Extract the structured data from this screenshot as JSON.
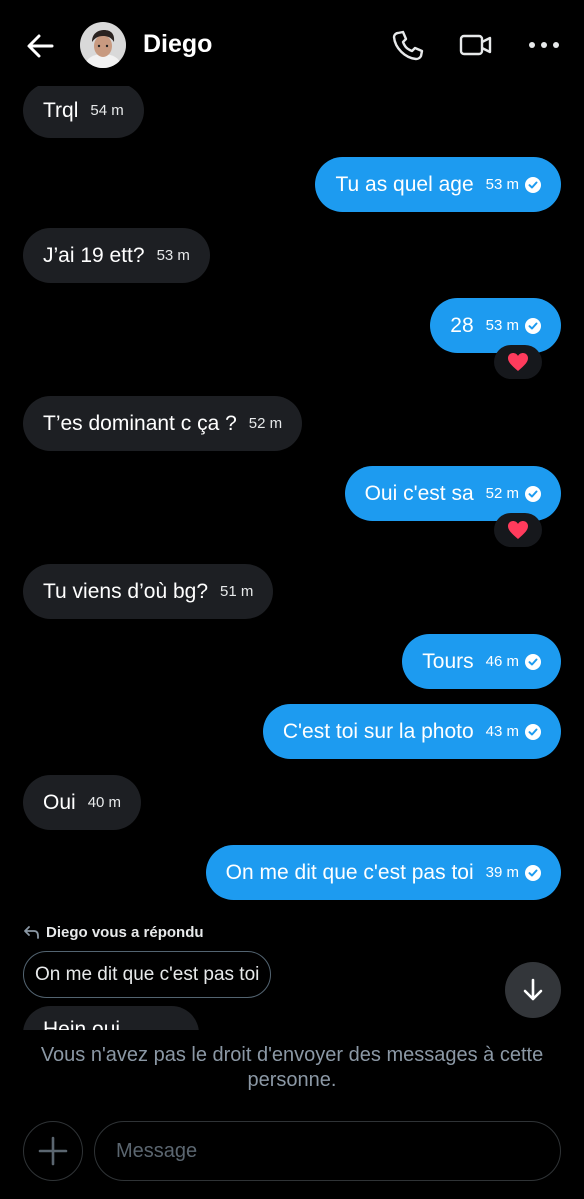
{
  "header": {
    "contact_name": "Diego",
    "icons": [
      "arrow-left-icon",
      "phone-icon",
      "video-camera-icon",
      "more-horizontal-icon"
    ]
  },
  "messages": [
    {
      "dir": "in",
      "text": "Trql",
      "time": "54 m"
    },
    {
      "dir": "out",
      "text": "Tu as  quel age",
      "time": "53 m",
      "seen": true
    },
    {
      "dir": "in",
      "text": "J’ai 19 ett?",
      "time": "53 m"
    },
    {
      "dir": "out",
      "text": "28",
      "time": "53 m",
      "seen": true,
      "reaction": "❤️"
    },
    {
      "dir": "in",
      "text": "T’es dominant c ça ?",
      "time": "52 m"
    },
    {
      "dir": "out",
      "text": "Oui c'est sa",
      "time": "52 m",
      "seen": true,
      "reaction": "❤️"
    },
    {
      "dir": "in",
      "text": "Tu viens d’où bg?",
      "time": "51 m"
    },
    {
      "dir": "out",
      "text": "Tours",
      "time": "46 m",
      "seen": true
    },
    {
      "dir": "out",
      "text": "C'est  toi sur la photo",
      "time": "43 m",
      "seen": true
    },
    {
      "dir": "in",
      "text": "Oui",
      "time": "40 m"
    },
    {
      "dir": "out",
      "text": "On me dit  que  c'est  pas toi",
      "time": "39 m",
      "seen": true
    }
  ],
  "reply": {
    "label": "Diego vous a répondu",
    "quoted_text": "On me dit  que  c'est  pas toi",
    "partial_text": "Hein oui ..."
  },
  "footer": {
    "notice": "Vous n'avez pas le droit d'envoyer des messages à cette personne.",
    "input_placeholder": "Message"
  },
  "colors": {
    "outgoing_bubble": "#1d9bf0",
    "incoming_bubble": "#1d1f23",
    "background": "#000000",
    "muted_text": "#8b98a5"
  }
}
